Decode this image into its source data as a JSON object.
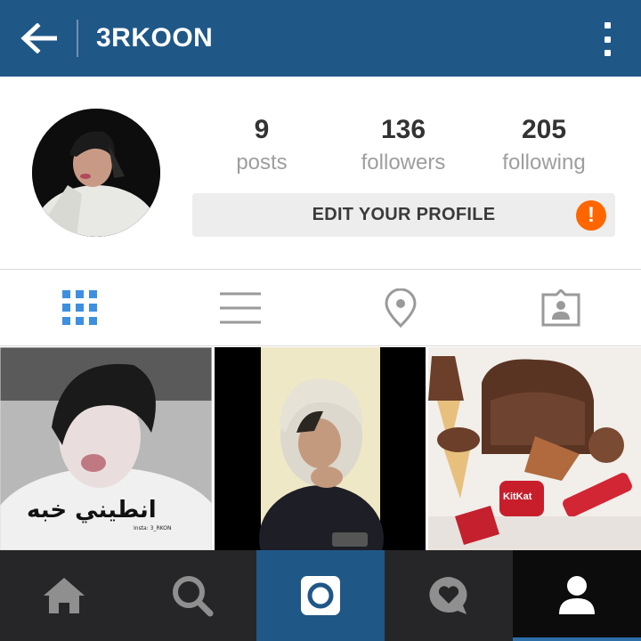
{
  "header": {
    "title": "3RKOON",
    "back_icon": "arrow-left-icon",
    "menu_icon": "more-vert-icon",
    "bg_color": "#1f5787"
  },
  "profile": {
    "stats": [
      {
        "value": "9",
        "label": "posts"
      },
      {
        "value": "136",
        "label": "followers"
      },
      {
        "value": "205",
        "label": "following"
      }
    ],
    "edit_button_label": "EDIT YOUR PROFILE",
    "alert_badge": "!",
    "alert_color": "#ff6600"
  },
  "tabs": [
    {
      "name": "grid",
      "icon": "grid-icon",
      "active": true
    },
    {
      "name": "list",
      "icon": "list-icon",
      "active": false
    },
    {
      "name": "map",
      "icon": "location-pin-icon",
      "active": false
    },
    {
      "name": "tagged",
      "icon": "tagged-photo-icon",
      "active": false
    }
  ],
  "photos": [
    {
      "icon": "photo-thumbnail",
      "overlay_text": "انطيني خبه",
      "caption": "Insta: 3_RKON"
    },
    {
      "icon": "photo-thumbnail"
    },
    {
      "icon": "photo-thumbnail",
      "overlay_text": "KitKat"
    }
  ],
  "bottom_nav": [
    {
      "name": "home",
      "icon": "home-icon"
    },
    {
      "name": "search",
      "icon": "search-icon"
    },
    {
      "name": "camera",
      "icon": "camera-icon"
    },
    {
      "name": "activity",
      "icon": "heart-bubble-icon"
    },
    {
      "name": "profile",
      "icon": "person-icon",
      "active": true
    }
  ],
  "colors": {
    "accent": "#3d8fe0",
    "brand": "#1f5787",
    "nav_bg": "#262628"
  }
}
